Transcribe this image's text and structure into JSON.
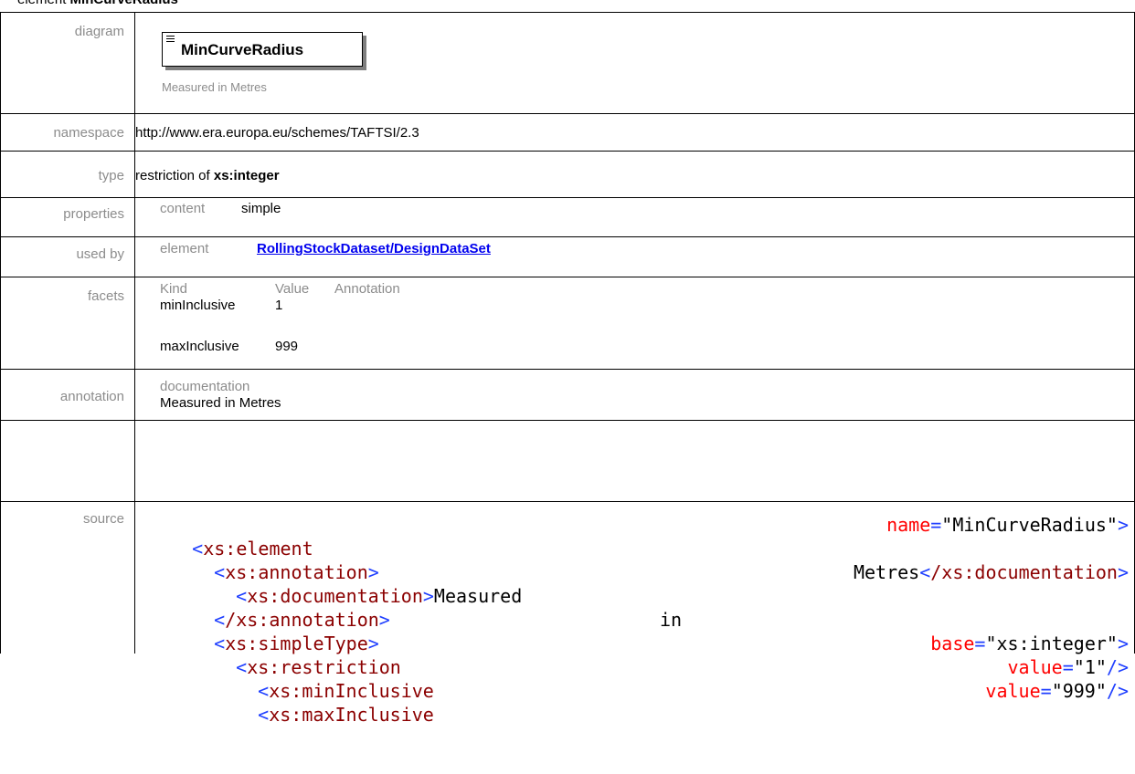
{
  "heading": {
    "prefix": "element ",
    "name": "MinCurveRadius"
  },
  "rows": {
    "diagram": {
      "label": "diagram",
      "element_name": "MinCurveRadius",
      "caption": "Measured in Metres"
    },
    "namespace": {
      "label": "namespace",
      "value": "http://www.era.europa.eu/schemes/TAFTSI/2.3"
    },
    "type": {
      "label": "type",
      "prefix": "restriction of ",
      "base": "xs:integer"
    },
    "properties": {
      "label": "properties",
      "key": "content",
      "value": "simple"
    },
    "used_by": {
      "label": "used by",
      "key": "element",
      "link": "RollingStockDataset/DesignDataSet"
    },
    "facets": {
      "label": "facets",
      "headers": [
        "Kind",
        "Value",
        "Annotation"
      ],
      "items": [
        {
          "kind": "minInclusive",
          "value": "1"
        },
        {
          "kind": "maxInclusive",
          "value": "999"
        }
      ]
    },
    "annotation": {
      "label": "annotation",
      "key": "documentation",
      "value": "Measured in Metres"
    },
    "source": {
      "label": "source",
      "l1_tag": "xs:element",
      "l1_attr": "name",
      "l1_val": "\"MinCurveRadius\"",
      "l2_tag": "xs:annotation",
      "l3_tag": "xs:documentation",
      "l3_w1": "Measured",
      "l3_w2": "in",
      "l3_w3": "Metres",
      "l3_close": "/xs:documentation",
      "l4_close": "/xs:annotation",
      "l5_tag": "xs:simpleType",
      "l6_tag": "xs:restriction",
      "l6_attr": "base",
      "l6_val": "\"xs:integer\"",
      "l7_tag": "xs:minInclusive",
      "l7_attr": "value",
      "l7_val": "\"1\"",
      "l8_tag": "xs:maxInclusive",
      "l8_attr": "value",
      "l8_val": "\"999\""
    }
  }
}
